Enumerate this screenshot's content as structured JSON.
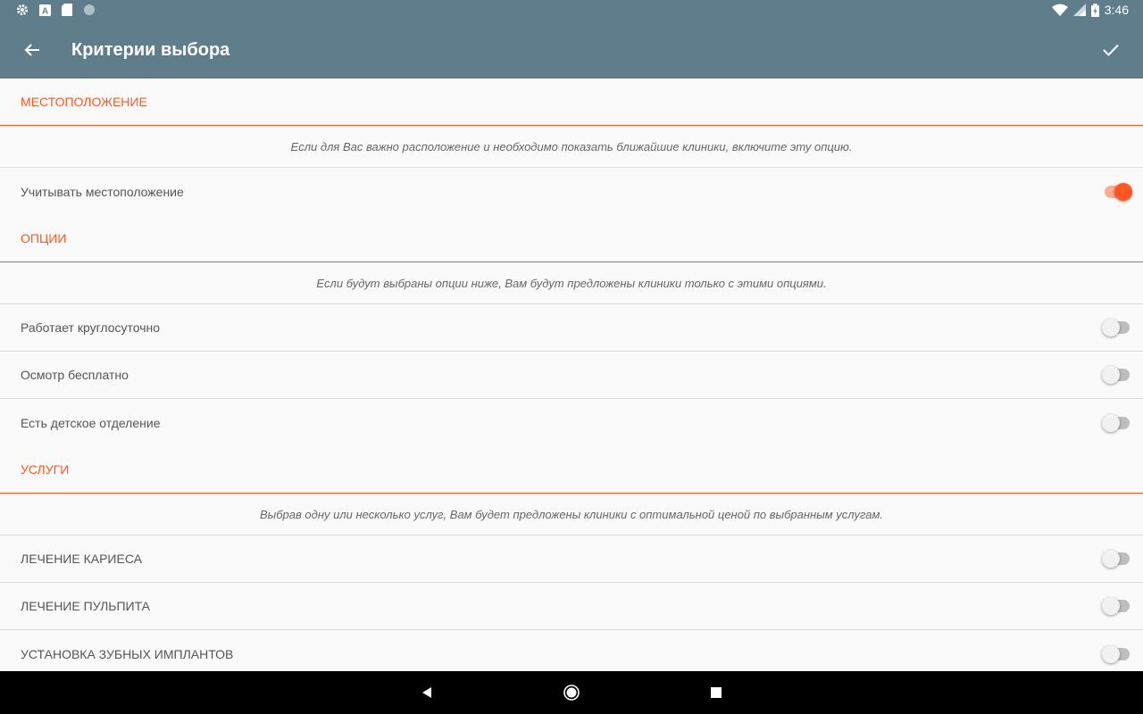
{
  "status_bar": {
    "time": "3:46",
    "icons": [
      "gear-icon",
      "a-icon",
      "sd-card-icon",
      "circle-icon",
      "wifi-icon",
      "signal-icon",
      "battery-icon"
    ]
  },
  "app_bar": {
    "title": "Критерии выбора",
    "back_icon": "arrow-back-icon",
    "confirm_icon": "check-icon",
    "color": "#607d8b"
  },
  "sections": {
    "location": {
      "header": "МЕСТОПОЛОЖЕНИЕ",
      "description": "Если для Вас важно расположение и необходимо показать ближайшие клиники, включите эту опцию.",
      "items": [
        {
          "label": "Учитывать местоположение",
          "enabled": true
        }
      ]
    },
    "options": {
      "header": "ОПЦИИ",
      "description": "Если будут выбраны опции ниже, Вам будут предложены клиники только с этими опциями.",
      "items": [
        {
          "label": "Работает круглосуточно",
          "enabled": false
        },
        {
          "label": "Осмотр бесплатно",
          "enabled": false
        },
        {
          "label": "Есть детское отделение",
          "enabled": false
        }
      ]
    },
    "services": {
      "header": "УСЛУГИ",
      "description": "Выбрав одну или несколько услуг, Вам будет предложены клиники с оптимальной ценой по выбранным услугам.",
      "items": [
        {
          "label": "ЛЕЧЕНИЕ КАРИЕСА",
          "enabled": false
        },
        {
          "label": "ЛЕЧЕНИЕ ПУЛЬПИТА",
          "enabled": false
        },
        {
          "label": "УСТАНОВКА ЗУБНЫХ ИМПЛАНТОВ",
          "enabled": false
        }
      ]
    }
  },
  "nav_bar": {
    "icons": [
      "back-triangle-icon",
      "home-circle-icon",
      "recents-square-icon"
    ]
  },
  "colors": {
    "accent": "#ff5722",
    "primary": "#607d8b",
    "background": "#fafafa"
  }
}
